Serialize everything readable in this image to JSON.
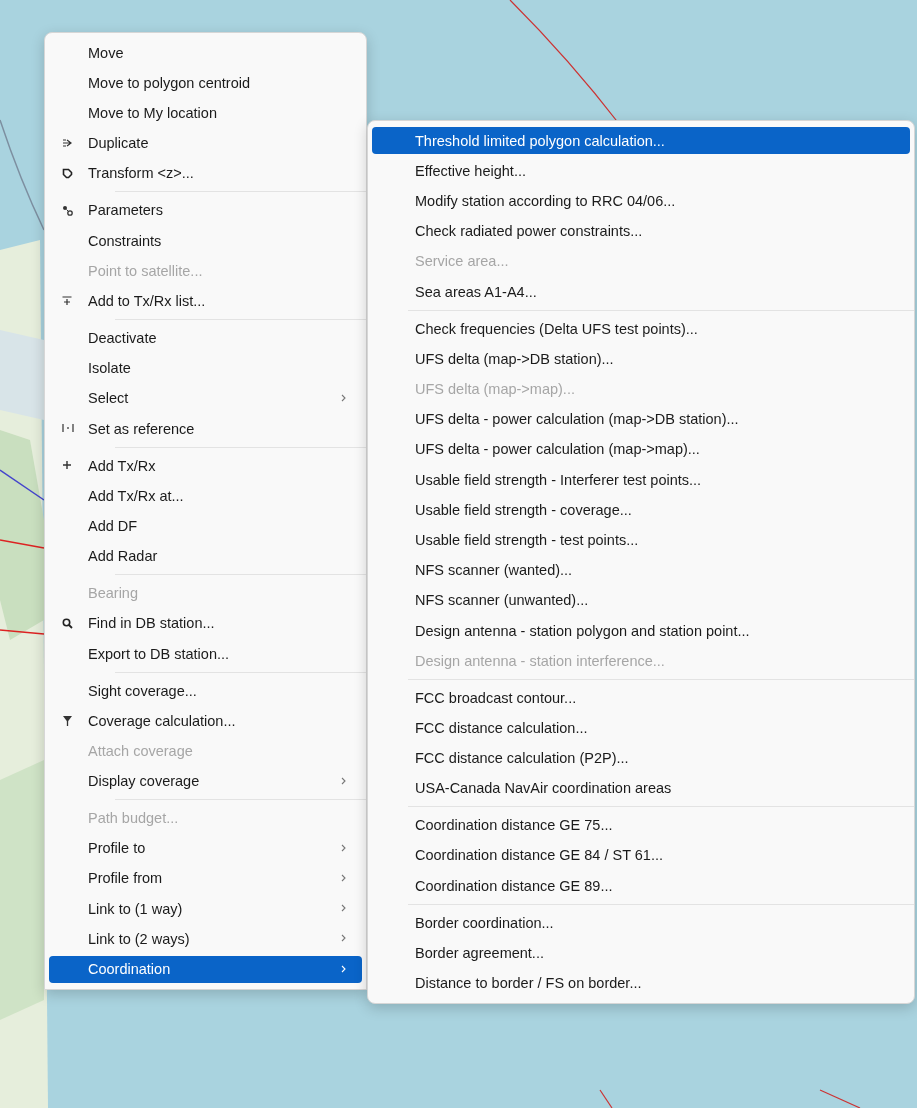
{
  "context_menu": {
    "groups": [
      [
        {
          "label": "Move",
          "disabled": false,
          "selected": false
        },
        {
          "label": "Move to polygon centroid",
          "disabled": false,
          "selected": false
        },
        {
          "label": "Move to My location",
          "disabled": false,
          "selected": false
        },
        {
          "label": "Duplicate",
          "disabled": false,
          "selected": false,
          "kind": "duplicate"
        },
        {
          "label": "Transform <z>...",
          "disabled": false,
          "selected": false,
          "kind": "transform"
        }
      ],
      [
        {
          "label": "Parameters",
          "disabled": false,
          "selected": false,
          "kind": "parameters"
        },
        {
          "label": "Constraints",
          "disabled": false,
          "selected": false
        },
        {
          "label": "Point to satellite...",
          "disabled": true,
          "selected": false
        },
        {
          "label": "Add to Tx/Rx list...",
          "disabled": false,
          "selected": false,
          "kind": "addlist"
        }
      ],
      [
        {
          "label": "Deactivate",
          "disabled": false,
          "selected": false
        },
        {
          "label": "Isolate",
          "disabled": false,
          "selected": false
        },
        {
          "label": "Select",
          "disabled": false,
          "selected": false,
          "submenu": true
        },
        {
          "label": "Set as reference",
          "disabled": false,
          "selected": false,
          "kind": "reference"
        }
      ],
      [
        {
          "label": "Add Tx/Rx",
          "disabled": false,
          "selected": false,
          "kind": "add"
        },
        {
          "label": "Add Tx/Rx at...",
          "disabled": false,
          "selected": false
        },
        {
          "label": "Add DF",
          "disabled": false,
          "selected": false
        },
        {
          "label": "Add Radar",
          "disabled": false,
          "selected": false
        }
      ],
      [
        {
          "label": "Bearing",
          "disabled": true,
          "selected": false
        },
        {
          "label": "Find in DB station...",
          "disabled": false,
          "selected": false,
          "kind": "find"
        },
        {
          "label": "Export to DB station...",
          "disabled": false,
          "selected": false
        }
      ],
      [
        {
          "label": "Sight coverage...",
          "disabled": false,
          "selected": false
        },
        {
          "label": "Coverage calculation...",
          "disabled": false,
          "selected": false,
          "kind": "coverage"
        },
        {
          "label": "Attach coverage",
          "disabled": true,
          "selected": false
        },
        {
          "label": "Display coverage",
          "disabled": false,
          "selected": false,
          "submenu": true
        }
      ],
      [
        {
          "label": "Path budget...",
          "disabled": true,
          "selected": false
        },
        {
          "label": "Profile to",
          "disabled": false,
          "selected": false,
          "submenu": true
        },
        {
          "label": "Profile from",
          "disabled": false,
          "selected": false,
          "submenu": true
        },
        {
          "label": "Link to (1 way)",
          "disabled": false,
          "selected": false,
          "submenu": true
        },
        {
          "label": "Link to (2 ways)",
          "disabled": false,
          "selected": false,
          "submenu": true
        },
        {
          "label": "Coordination",
          "disabled": false,
          "selected": true,
          "submenu": true
        }
      ]
    ]
  },
  "submenu": {
    "groups": [
      [
        {
          "label": "Threshold limited polygon calculation...",
          "disabled": false,
          "selected": true
        },
        {
          "label": "Effective height...",
          "disabled": false,
          "selected": false
        },
        {
          "label": "Modify station according to RRC 04/06...",
          "disabled": false,
          "selected": false
        },
        {
          "label": "Check radiated power constraints...",
          "disabled": false,
          "selected": false
        },
        {
          "label": "Service area...",
          "disabled": true,
          "selected": false
        },
        {
          "label": "Sea areas A1-A4...",
          "disabled": false,
          "selected": false
        }
      ],
      [
        {
          "label": "Check frequencies (Delta UFS test points)...",
          "disabled": false,
          "selected": false
        },
        {
          "label": "UFS delta (map->DB station)...",
          "disabled": false,
          "selected": false
        },
        {
          "label": "UFS delta (map->map)...",
          "disabled": true,
          "selected": false
        },
        {
          "label": "UFS delta - power calculation (map->DB station)...",
          "disabled": false,
          "selected": false
        },
        {
          "label": "UFS delta - power calculation (map->map)...",
          "disabled": false,
          "selected": false
        },
        {
          "label": "Usable field strength - Interferer test points...",
          "disabled": false,
          "selected": false
        },
        {
          "label": "Usable field strength - coverage...",
          "disabled": false,
          "selected": false
        },
        {
          "label": "Usable field strength - test points...",
          "disabled": false,
          "selected": false
        },
        {
          "label": "NFS scanner (wanted)...",
          "disabled": false,
          "selected": false
        },
        {
          "label": "NFS scanner (unwanted)...",
          "disabled": false,
          "selected": false
        },
        {
          "label": "Design antenna - station polygon and station point...",
          "disabled": false,
          "selected": false
        },
        {
          "label": "Design antenna - station interference...",
          "disabled": true,
          "selected": false
        }
      ],
      [
        {
          "label": "FCC broadcast contour...",
          "disabled": false,
          "selected": false
        },
        {
          "label": "FCC distance calculation...",
          "disabled": false,
          "selected": false
        },
        {
          "label": "FCC distance calculation (P2P)...",
          "disabled": false,
          "selected": false
        },
        {
          "label": "USA-Canada NavAir coordination areas",
          "disabled": false,
          "selected": false
        }
      ],
      [
        {
          "label": "Coordination distance GE 75...",
          "disabled": false,
          "selected": false
        },
        {
          "label": "Coordination distance GE 84 / ST 61...",
          "disabled": false,
          "selected": false
        },
        {
          "label": "Coordination distance GE 89...",
          "disabled": false,
          "selected": false
        }
      ],
      [
        {
          "label": "Border coordination...",
          "disabled": false,
          "selected": false
        },
        {
          "label": "Border agreement...",
          "disabled": false,
          "selected": false
        },
        {
          "label": "Distance to border / FS on border...",
          "disabled": false,
          "selected": false
        }
      ]
    ]
  }
}
